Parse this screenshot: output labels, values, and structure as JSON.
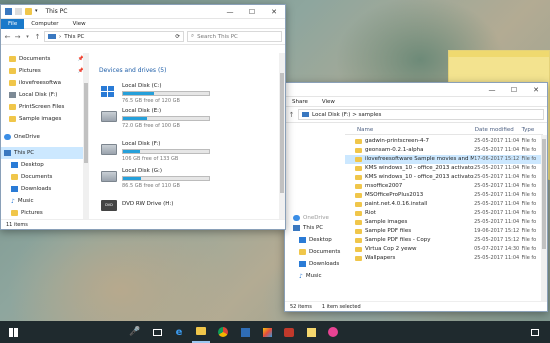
{
  "left": {
    "title": "This PC",
    "tabs": [
      "File",
      "Computer",
      "View"
    ],
    "path": "This PC",
    "search_placeholder": "Search This PC",
    "nav": [
      {
        "label": "Documents",
        "pin": "📌"
      },
      {
        "label": "Pictures",
        "pin": "📌"
      },
      {
        "label": "ilovefreesoftwa"
      },
      {
        "label": "Local Disk (F:)"
      },
      {
        "label": "PrintScreen Files"
      },
      {
        "label": "Sample images"
      },
      {
        "label": "OneDrive"
      },
      {
        "label": "This PC"
      },
      {
        "label": "Desktop"
      },
      {
        "label": "Documents"
      },
      {
        "label": "Downloads"
      },
      {
        "label": "Music"
      },
      {
        "label": "Pictures"
      }
    ],
    "section_header": "Devices and drives (5)",
    "drives": [
      {
        "name": "Local Disk (C:)",
        "free": "76.5 GB free of 120 GB",
        "used": 0.36
      },
      {
        "name": "Local Disk (E:)",
        "free": "72.0 GB free of 100 GB",
        "used": 0.28
      },
      {
        "name": "Local Disk (F:)",
        "free": "106 GB free of 133 GB",
        "used": 0.2
      },
      {
        "name": "Local Disk (G:)",
        "free": "86.5 GB free of 110 GB",
        "used": 0.21
      },
      {
        "name": "DVD RW Drive (H:)",
        "free": ""
      }
    ],
    "status": "11 items"
  },
  "right": {
    "tabs": [
      "Share",
      "View"
    ],
    "path": "Local Disk (F:)  >  samples",
    "columns": [
      "Name",
      "Date modified",
      "Type"
    ],
    "files": [
      {
        "name": "gadwin-printscreen-4-7",
        "date": "25-05-2017 11:04",
        "type": "File fo"
      },
      {
        "name": "geonsam-0.2.1-alpha",
        "date": "25-05-2017 11:04",
        "type": "File fo"
      },
      {
        "name": "ilovefreesoftware Sample movies and MP3",
        "date": "17-06-2017 15:12",
        "type": "File fo"
      },
      {
        "name": "KMS windows_10 - office_2013 activator",
        "date": "25-05-2017 11:04",
        "type": "File fo"
      },
      {
        "name": "KMS windows_10 - office_2013 activator",
        "date": "25-05-2017 11:04",
        "type": "File fo"
      },
      {
        "name": "msoffice2007",
        "date": "25-05-2017 11:04",
        "type": "File fo"
      },
      {
        "name": "MSOfficeProPlus2013",
        "date": "25-05-2017 11:04",
        "type": "File fo"
      },
      {
        "name": "paint.net.4.0.16.install",
        "date": "25-05-2017 11:04",
        "type": "File fo"
      },
      {
        "name": "Riot",
        "date": "25-05-2017 11:04",
        "type": "File fo"
      },
      {
        "name": "Sample images",
        "date": "25-05-2017 11:04",
        "type": "File fo"
      },
      {
        "name": "Sample PDF files",
        "date": "19-06-2017 15:12",
        "type": "File fo"
      },
      {
        "name": "Sample PDF files - Copy",
        "date": "25-05-2017 15:12",
        "type": "File fo"
      },
      {
        "name": "Virtua Cop 2 yeww",
        "date": "05-07-2017 14:30",
        "type": "File fo"
      },
      {
        "name": "Wallpapers",
        "date": "25-05-2017 11:04",
        "type": "File fo"
      }
    ],
    "side": [
      "OneDrive",
      "This PC",
      "Desktop",
      "Documents",
      "Downloads",
      "Music"
    ],
    "status_items": "52 items",
    "status_sel": "1 item selected"
  }
}
